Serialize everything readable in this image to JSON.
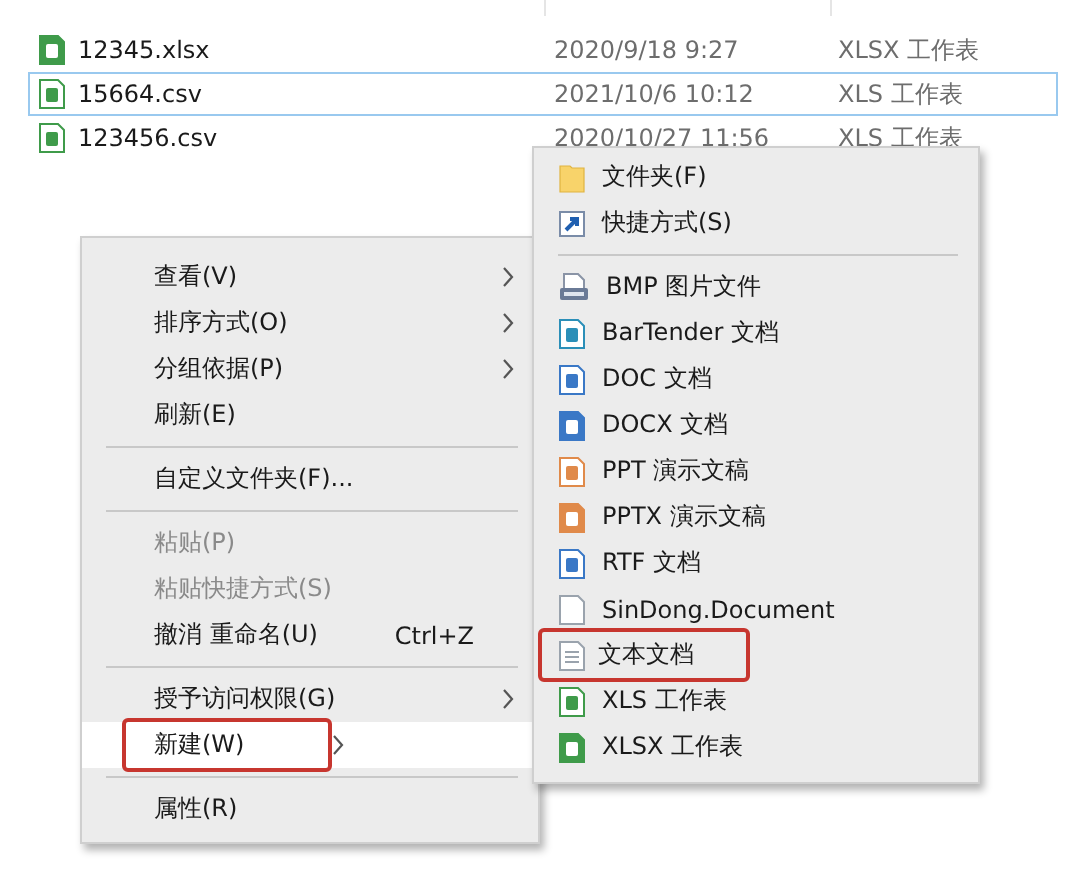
{
  "files": [
    {
      "name": "12345.xlsx",
      "modified": "2020/9/18 9:27",
      "type": "XLSX 工作表",
      "selected": false
    },
    {
      "name": "15664.csv",
      "modified": "2021/10/6 10:12",
      "type": "XLS 工作表",
      "selected": true
    },
    {
      "name": "123456.csv",
      "modified": "2020/10/27 11:56",
      "type": "XLS 工作表",
      "selected": false
    }
  ],
  "context_menu": {
    "items": [
      {
        "kind": "item",
        "label": "查看(V)",
        "submenu": true,
        "disabled": false,
        "selected": false,
        "annotated": false
      },
      {
        "kind": "item",
        "label": "排序方式(O)",
        "submenu": true,
        "disabled": false,
        "selected": false,
        "annotated": false
      },
      {
        "kind": "item",
        "label": "分组依据(P)",
        "submenu": true,
        "disabled": false,
        "selected": false,
        "annotated": false
      },
      {
        "kind": "item",
        "label": "刷新(E)",
        "submenu": false,
        "disabled": false,
        "selected": false,
        "annotated": false
      },
      {
        "kind": "separator"
      },
      {
        "kind": "item",
        "label": "自定义文件夹(F)...",
        "submenu": false,
        "disabled": false,
        "selected": false,
        "annotated": false
      },
      {
        "kind": "separator"
      },
      {
        "kind": "item",
        "label": "粘贴(P)",
        "submenu": false,
        "disabled": true,
        "selected": false,
        "annotated": false
      },
      {
        "kind": "item",
        "label": "粘贴快捷方式(S)",
        "submenu": false,
        "disabled": true,
        "selected": false,
        "annotated": false
      },
      {
        "kind": "item",
        "label": "撤消 重命名(U)",
        "shortcut": "Ctrl+Z",
        "submenu": false,
        "disabled": false,
        "selected": false,
        "annotated": false
      },
      {
        "kind": "separator"
      },
      {
        "kind": "item",
        "label": "授予访问权限(G)",
        "submenu": true,
        "disabled": false,
        "selected": false,
        "annotated": false
      },
      {
        "kind": "item",
        "label": "新建(W)",
        "submenu": true,
        "disabled": false,
        "selected": true,
        "annotated": true
      },
      {
        "kind": "separator"
      },
      {
        "kind": "item",
        "label": "属性(R)",
        "submenu": false,
        "disabled": false,
        "selected": false,
        "annotated": false
      }
    ]
  },
  "new_submenu": {
    "items": [
      {
        "kind": "folder",
        "label": "文件夹(F)",
        "annotated": false
      },
      {
        "kind": "shortcut",
        "label": "快捷方式(S)",
        "annotated": false
      },
      {
        "kind": "separator"
      },
      {
        "kind": "bmp",
        "label": "BMP 图片文件",
        "annotated": false
      },
      {
        "kind": "bartender",
        "label": "BarTender 文档",
        "annotated": false
      },
      {
        "kind": "doc",
        "label": "DOC 文档",
        "annotated": false
      },
      {
        "kind": "docx",
        "label": "DOCX 文档",
        "annotated": false
      },
      {
        "kind": "ppt",
        "label": "PPT 演示文稿",
        "annotated": false
      },
      {
        "kind": "pptx",
        "label": "PPTX 演示文稿",
        "annotated": false
      },
      {
        "kind": "rtf",
        "label": "RTF 文档",
        "annotated": false
      },
      {
        "kind": "blank",
        "label": "SinDong.Document",
        "annotated": false
      },
      {
        "kind": "text",
        "label": "文本文档",
        "annotated": true
      },
      {
        "kind": "xls",
        "label": "XLS 工作表",
        "annotated": false
      },
      {
        "kind": "xlsx",
        "label": "XLSX 工作表",
        "annotated": false
      }
    ]
  }
}
